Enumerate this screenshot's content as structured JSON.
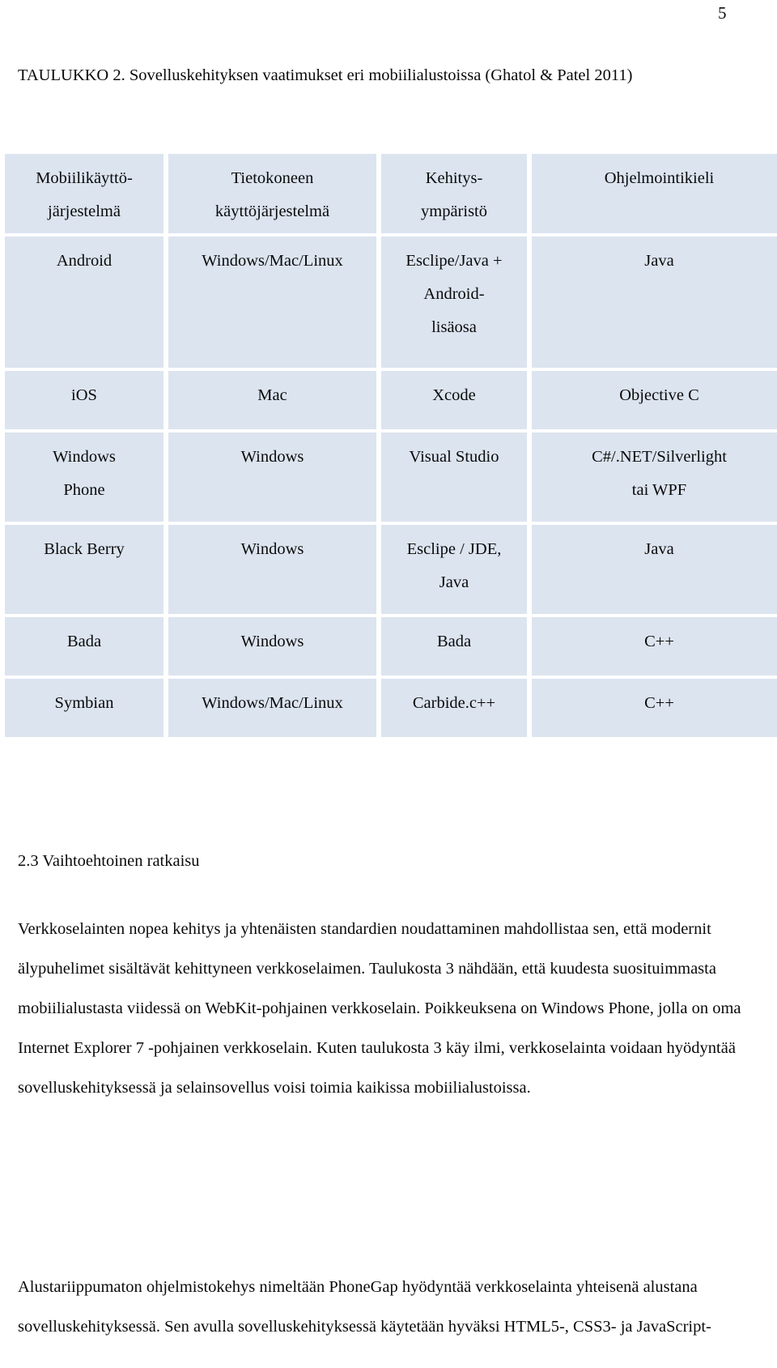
{
  "page": {
    "number": "5"
  },
  "table_caption": "TAULUKKO 2. Sovelluskehityksen vaatimukset eri mobiilialustoissa (Ghatol & Patel 2011)",
  "table": {
    "headers": [
      "Mobiilikäyttö-\njärjestelmä",
      "Tietokoneen\nkäyttöjärjestelmä",
      "Kehitys-\nympäristö",
      "Ohjelmointikieli"
    ],
    "rows": [
      {
        "os": "Android",
        "computer_os": "Windows/Mac/Linux",
        "environment": "Esclipe/Java +\nAndroid-\nlisäosa",
        "language": "Java"
      },
      {
        "os": "iOS",
        "computer_os": "Mac",
        "environment": "Xcode",
        "language": "Objective C"
      },
      {
        "os": "Windows\nPhone",
        "computer_os": "Windows",
        "environment": "Visual Studio",
        "language": "C#/.NET/Silverlight\ntai WPF"
      },
      {
        "os": "Black Berry",
        "computer_os": "Windows",
        "environment": "Esclipe / JDE,\nJava",
        "language": "Java"
      },
      {
        "os": "Bada",
        "computer_os": "Windows",
        "environment": "Bada",
        "language": "C++"
      },
      {
        "os": "Symbian",
        "computer_os": "Windows/Mac/Linux",
        "environment": "Carbide.c++",
        "language": "C++"
      }
    ]
  },
  "section": {
    "number": "2.3",
    "title": "Vaihtoehtoinen ratkaisu",
    "heading_full": "2.3    Vaihtoehtoinen ratkaisu"
  },
  "paragraphs": {
    "p1": "Verkkoselainten nopea kehitys ja yhtenäisten standardien noudattaminen mahdollistaa sen, että modernit älypuhelimet sisältävät kehittyneen verkkoselaimen. Taulukosta 3 nähdään, että kuudesta suosituimmasta mobiilialustasta viidessä on WebKit-pohjainen verkkoselain. Poikkeuksena on Windows Phone, jolla on oma Internet Explorer 7 -pohjainen verkkoselain. Kuten taulukosta 3 käy ilmi, verkkoselainta voidaan hyödyntää sovelluskehityksessä ja selainsovellus voisi toimia kaikissa mobiilialustoissa.",
    "p2": "Alustariippumaton ohjelmistokehys nimeltään PhoneGap hyödyntää verkkoselainta yhteisenä alustana sovelluskehityksessä. Sen avulla sovelluskehityksessä käytetään hyväksi HTML5-, CSS3- ja JavaScript-"
  },
  "colors": {
    "cell_background": "#dce4ef",
    "page_background": "#ffffff",
    "text": "#0a0a0a"
  }
}
